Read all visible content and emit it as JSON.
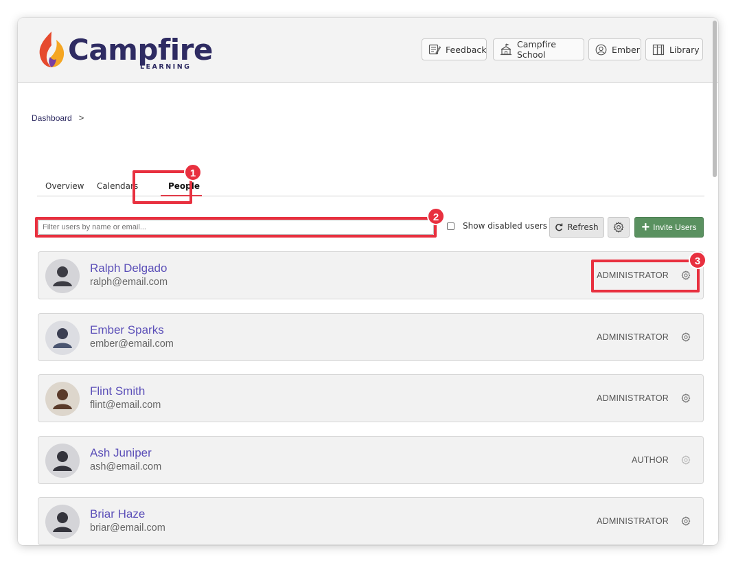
{
  "header": {
    "logo_text": "Campfire",
    "logo_sub": "LEARNING",
    "buttons": [
      {
        "label": "Feedback",
        "icon": "feedback-icon"
      },
      {
        "label": "Campfire School",
        "icon": "school-icon"
      },
      {
        "label": "Ember",
        "icon": "user-circle-icon"
      },
      {
        "label": "Library",
        "icon": "library-icon"
      }
    ]
  },
  "breadcrumb": {
    "item": "Dashboard",
    "separator": ">"
  },
  "tabs": [
    "Overview",
    "Calendars",
    "People"
  ],
  "active_tab": "People",
  "toolbar": {
    "filter_placeholder": "Filter users by name or email...",
    "show_disabled_label": "Show disabled users",
    "refresh_label": "Refresh",
    "invite_label": "Invite Users"
  },
  "users": [
    {
      "name": "Ralph Delgado",
      "email": "ralph@email.com",
      "role": "ADMINISTRATOR"
    },
    {
      "name": "Ember Sparks",
      "email": "ember@email.com",
      "role": "ADMINISTRATOR"
    },
    {
      "name": "Flint Smith",
      "email": "flint@email.com",
      "role": "ADMINISTRATOR"
    },
    {
      "name": "Ash Juniper",
      "email": "ash@email.com",
      "role": "AUTHOR"
    },
    {
      "name": "Briar Haze",
      "email": "briar@email.com",
      "role": "ADMINISTRATOR"
    }
  ],
  "annotations": [
    "1",
    "2",
    "3"
  ],
  "colors": {
    "brand": "#2e2b62",
    "link": "#5b4fb8",
    "invite": "#5a9160",
    "annotation": "#e8303f",
    "tab_active": "#e03a47"
  }
}
